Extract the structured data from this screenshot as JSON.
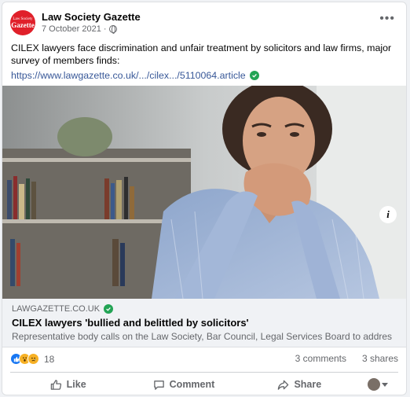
{
  "post": {
    "page_name": "Law Society Gazette",
    "avatar_small_text": "Law Society",
    "avatar_big_text": "Gazette",
    "date": "7 October 2021",
    "separator": "·",
    "privacy_icon": "globe-icon",
    "more_icon": "more-options-icon",
    "text": "CILEX lawyers face discrimination and unfair treatment by solicitors and law firms, major survey of members finds:",
    "link": "https://www.lawgazette.co.uk/.../cilex.../5110064.article"
  },
  "link_preview": {
    "domain": "LAWGAZETTE.CO.UK",
    "title": "CILEX lawyers 'bullied and belittled by solicitors'",
    "description": "Representative body calls on the Law Society, Bar Council, Legal Services Board to address the ..."
  },
  "stats": {
    "reaction_count": "18",
    "comments": "3 comments",
    "shares": "3 shares",
    "reaction_icons": [
      "like-reaction-icon",
      "wow-reaction-icon",
      "sad-reaction-icon"
    ]
  },
  "actions": {
    "like": "Like",
    "comment": "Comment",
    "share": "Share"
  },
  "colors": {
    "link": "#385898",
    "verified": "#23a455",
    "avatar_bg": "#e0202a",
    "muted": "#65676b"
  }
}
